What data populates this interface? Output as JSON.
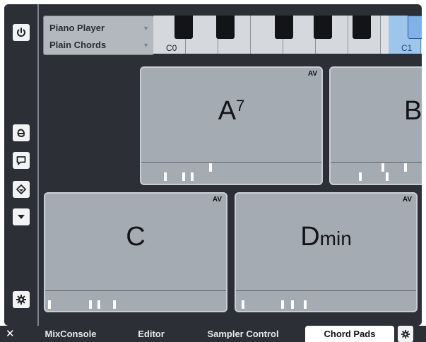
{
  "player": {
    "instrument": "Piano Player",
    "voicing": "Plain Chords"
  },
  "keyboard": {
    "labels": [
      "C0",
      "C1"
    ]
  },
  "pads": [
    {
      "id": "a7",
      "root": "A",
      "sup": "7",
      "qual": "",
      "badge": "AV"
    },
    {
      "id": "b",
      "root": "B",
      "sup": "",
      "qual": "",
      "badge": "AV"
    },
    {
      "id": "c",
      "root": "C",
      "sup": "",
      "qual": "",
      "badge": "AV"
    },
    {
      "id": "dmin",
      "root": "D",
      "sup": "",
      "qual": "min",
      "badge": "AV"
    }
  ],
  "tabs": {
    "mixconsole": "MixConsole",
    "editor": "Editor",
    "sampler": "Sampler Control",
    "chordpads": "Chord Pads",
    "close": "✕"
  },
  "toolbar": {
    "icons": [
      "power-icon",
      "edit-e-icon",
      "speech-bubble-icon",
      "tag-icon",
      "triangle-down-icon",
      "gear-icon"
    ]
  },
  "colors": {
    "panel": "#2c3036",
    "pad": "#a5abb3",
    "active_key": "#9ec5ea"
  }
}
